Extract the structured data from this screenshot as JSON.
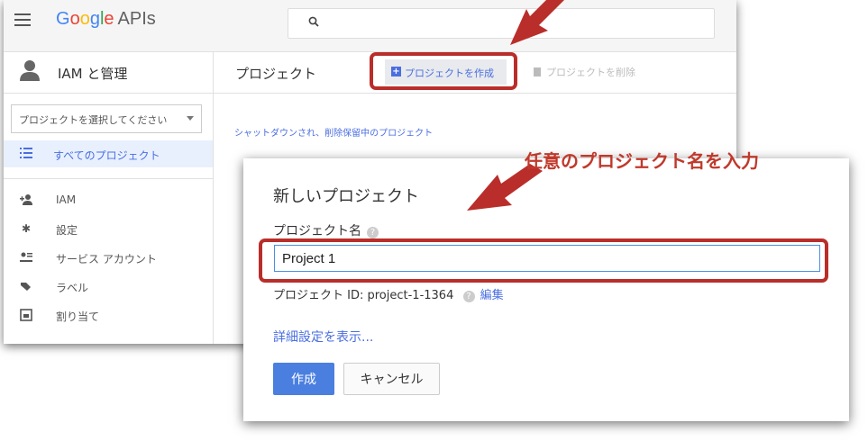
{
  "header": {
    "brand_google": [
      "G",
      "o",
      "o",
      "g",
      "l",
      "e"
    ],
    "brand_apis": "APIs"
  },
  "sidebar": {
    "title": "IAM と管理",
    "project_select": "プロジェクトを選択してください",
    "all_projects": "すべてのプロジェクト",
    "items": [
      {
        "icon": "add-person-icon",
        "label": "IAM"
      },
      {
        "icon": "gear-icon",
        "label": "設定"
      },
      {
        "icon": "service-account-icon",
        "label": "サービス アカウント"
      },
      {
        "icon": "tag-icon",
        "label": "ラベル"
      },
      {
        "icon": "quota-icon",
        "label": "割り当て"
      }
    ]
  },
  "main": {
    "title": "プロジェクト",
    "create_button": "プロジェクトを作成",
    "delete_button": "プロジェクトを削除",
    "shutdown_link": "シャットダウンされ、削除保留中のプロジェクト"
  },
  "dialog": {
    "title": "新しいプロジェクト",
    "name_label": "プロジェクト名",
    "name_value": "Project 1",
    "project_id_text": "プロジェクト ID: project-1-1364",
    "edit_link": "編集",
    "advanced_link": "詳細設定を表示...",
    "create_button": "作成",
    "cancel_button": "キャンセル"
  },
  "annotation": {
    "callout": "任意のプロジェクト名を入力",
    "color": "#b92e2a"
  }
}
